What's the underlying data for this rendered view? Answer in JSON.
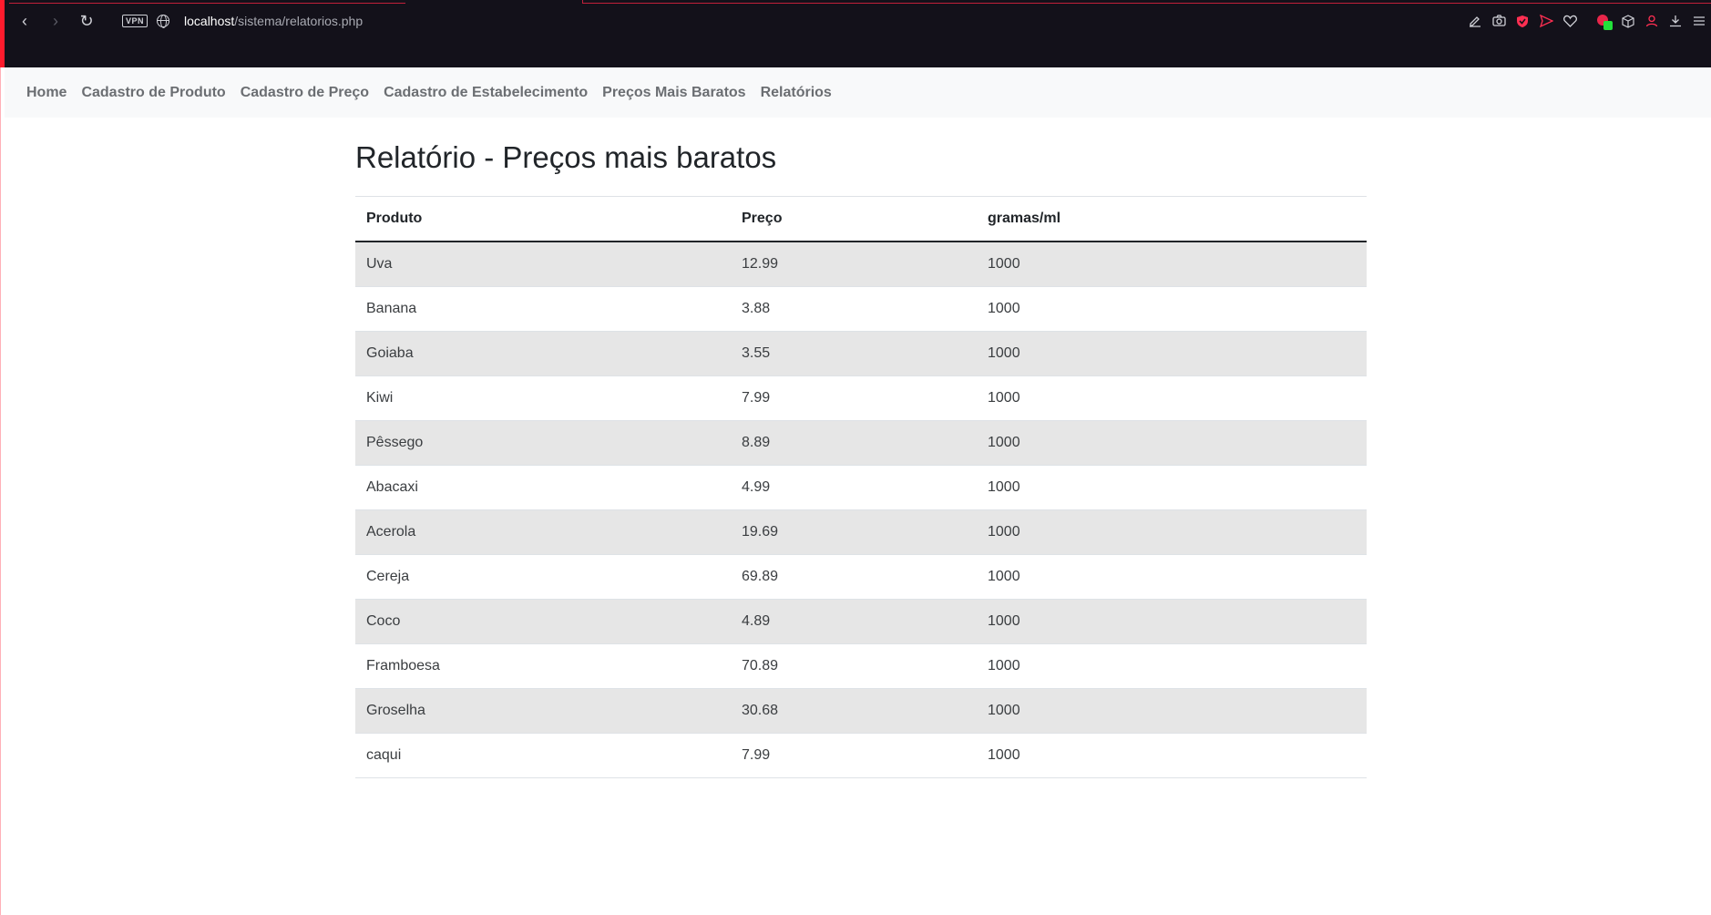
{
  "browser": {
    "url_host": "localhost",
    "url_path": "/sistema/relatorios.php",
    "vpn_label": "VPN",
    "back_glyph": "‹",
    "forward_glyph": "›",
    "reload_glyph": "↻",
    "toolbar_icons": [
      "edit-icon",
      "camera-icon",
      "shield-icon",
      "send-icon",
      "heart-icon",
      "extension-icon",
      "cube-icon",
      "profile-icon",
      "download-icon",
      "menu-icon"
    ]
  },
  "nav": {
    "items": [
      {
        "label": "Home"
      },
      {
        "label": "Cadastro de Produto"
      },
      {
        "label": "Cadastro de Preço"
      },
      {
        "label": "Cadastro de Estabelecimento"
      },
      {
        "label": "Preços Mais Baratos"
      },
      {
        "label": "Relatórios"
      }
    ]
  },
  "main": {
    "title": "Relatório - Preços mais baratos",
    "table": {
      "headers": [
        "Produto",
        "Preço",
        "gramas/ml"
      ],
      "rows": [
        [
          "Uva",
          "12.99",
          "1000"
        ],
        [
          "Banana",
          "3.88",
          "1000"
        ],
        [
          "Goiaba",
          "3.55",
          "1000"
        ],
        [
          "Kiwi",
          "7.99",
          "1000"
        ],
        [
          "Pêssego",
          "8.89",
          "1000"
        ],
        [
          "Abacaxi",
          "4.99",
          "1000"
        ],
        [
          "Acerola",
          "19.69",
          "1000"
        ],
        [
          "Cereja",
          "69.89",
          "1000"
        ],
        [
          "Coco",
          "4.89",
          "1000"
        ],
        [
          "Framboesa",
          "70.89",
          "1000"
        ],
        [
          "Groselha",
          "30.68",
          "1000"
        ],
        [
          "caqui",
          "7.99",
          "1000"
        ]
      ]
    }
  },
  "colors": {
    "browser_bg": "#13111a",
    "accent_red": "#ff1b2d",
    "nav_bg": "#f8f9fa",
    "stripe": "#e6e6e6"
  }
}
